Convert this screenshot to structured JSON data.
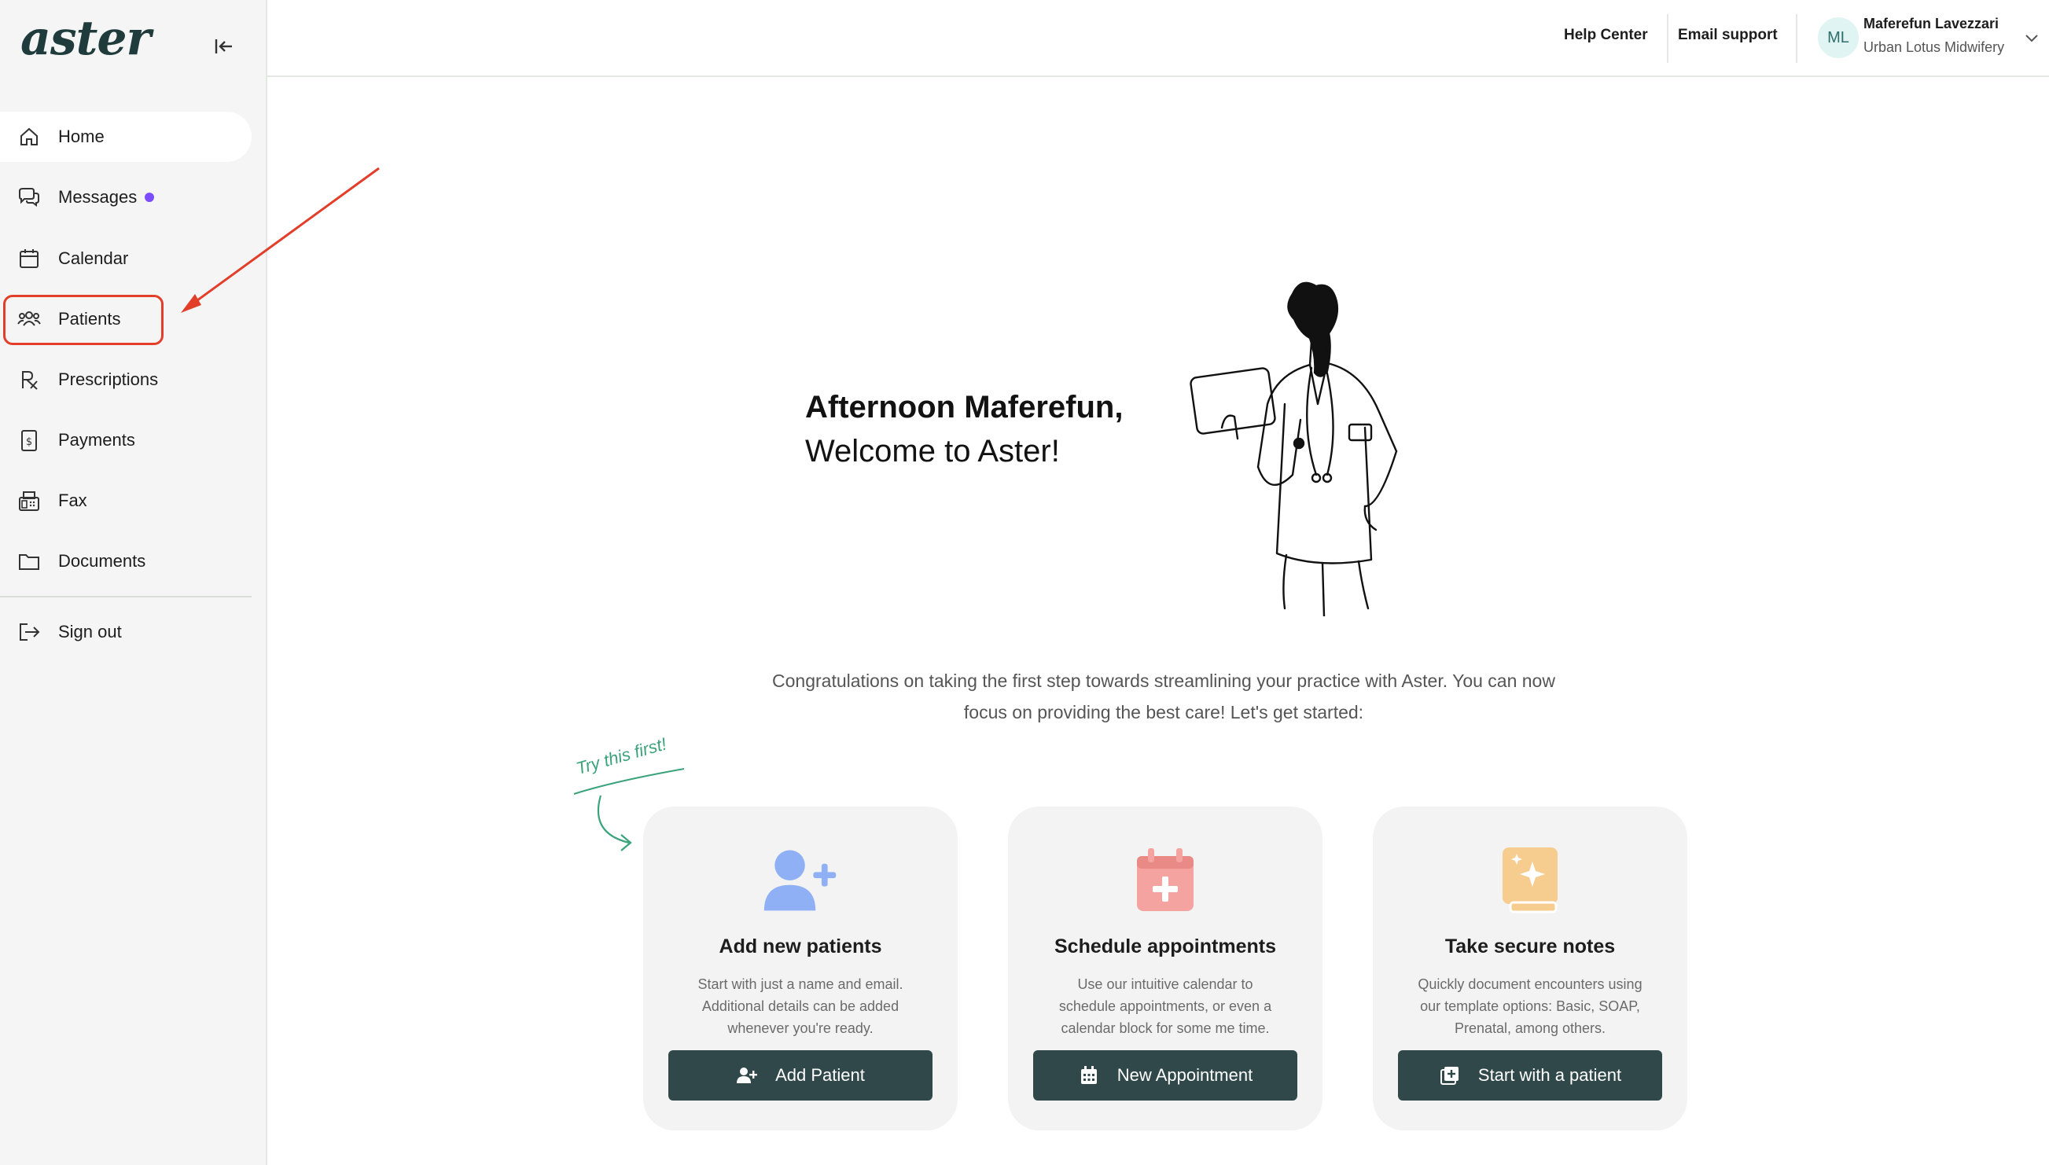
{
  "app": {
    "logo": "aster"
  },
  "sidebar": {
    "items": [
      {
        "label": "Home",
        "icon": "home-icon",
        "active": true
      },
      {
        "label": "Messages",
        "icon": "messages-icon",
        "unread": true
      },
      {
        "label": "Calendar",
        "icon": "calendar-icon"
      },
      {
        "label": "Patients",
        "icon": "patients-icon",
        "highlighted": true
      },
      {
        "label": "Prescriptions",
        "icon": "prescription-icon"
      },
      {
        "label": "Payments",
        "icon": "payments-icon"
      },
      {
        "label": "Fax",
        "icon": "fax-icon"
      },
      {
        "label": "Documents",
        "icon": "folder-icon"
      }
    ],
    "signout": "Sign out"
  },
  "header": {
    "help_center": "Help Center",
    "email_support": "Email support",
    "user": {
      "initials": "ML",
      "name": "Maferefun Lavezzari",
      "org": "Urban Lotus Midwifery"
    }
  },
  "main": {
    "greeting_line1": "Afternoon Maferefun,",
    "greeting_line2": "Welcome to Aster!",
    "intro": "Congratulations on taking the first step towards streamlining your practice with Aster. You can now focus on providing the best care! Let's get started:",
    "try_note": "Try this first!",
    "cards": [
      {
        "title": "Add new patients",
        "desc": "Start with just a name and email. Additional details can be added whenever you're ready.",
        "button": "Add Patient"
      },
      {
        "title": "Schedule appointments",
        "desc": "Use our intuitive calendar to schedule appointments, or even a calendar block for some me time.",
        "button": "New Appointment"
      },
      {
        "title": "Take secure notes",
        "desc": "Quickly document encounters using our template options: Basic, SOAP, Prenatal, among others.",
        "button": "Start with a patient"
      }
    ]
  },
  "colors": {
    "accent_button": "#31484a",
    "highlight": "#e23e2a",
    "unread_dot": "#7c4dff",
    "try_note": "#3aa37a"
  }
}
